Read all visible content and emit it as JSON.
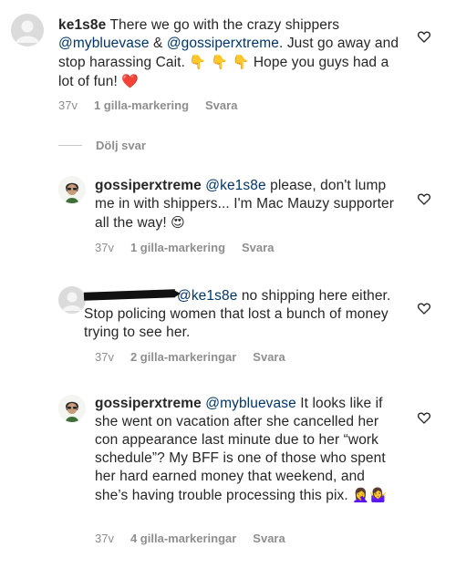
{
  "comments": [
    {
      "username": "ke1s8e",
      "text_parts": [
        "There we go with the crazy shippers ",
        "@mybluevase",
        " & ",
        "@gossiperxtreme",
        ". Just go away and stop harassing Cait. ",
        "👇 👇 👇",
        " Hope you guys had a lot of fun! ",
        "❤️"
      ],
      "time": "37v",
      "likes": "1 gilla-markering",
      "reply": "Svara"
    },
    {
      "username": "gossiperxtreme",
      "text_parts": [
        "@ke1s8e",
        " please, don't lump me in with shippers... I'm Mac Mauzy supporter all the way! ",
        "😍"
      ],
      "time": "37v",
      "likes": "1 gilla-markering",
      "reply": "Svara"
    },
    {
      "username": "",
      "text_parts": [
        "@ke1s8e",
        " no shipping here either. Stop policing women that lost a bunch of money trying to see her."
      ],
      "time": "37v",
      "likes": "2 gilla-markeringar",
      "reply": "Svara"
    },
    {
      "username": "gossiperxtreme",
      "text_parts": [
        "@mybluevase",
        " It looks like if she went on vacation after she cancelled her con appearance last minute due to her “work schedule”? My BFF is one of those who spent her hard earned money that weekend, and she’s having trouble processing this pix. ",
        "🤦‍♀️🤷‍♀️"
      ],
      "time": "37v",
      "likes": "4 gilla-markeringar",
      "reply": "Svara"
    }
  ],
  "hide_replies_label": "Dölj svar",
  "colors": {
    "text": "#262626",
    "meta": "#8e8e8e",
    "mention": "#003569"
  },
  "icons": {
    "like": "heart-outline-icon"
  }
}
